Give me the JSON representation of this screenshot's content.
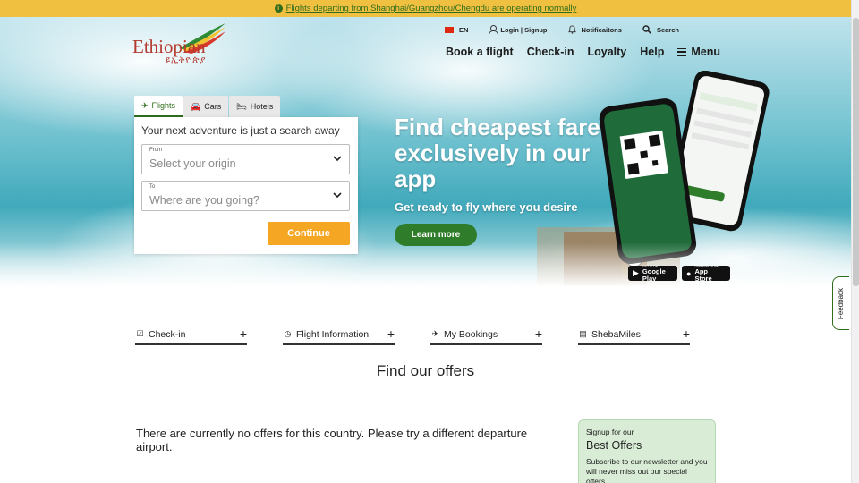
{
  "alert": {
    "text": "Flights departing from Shanghai/Guangzhou/Chengdu are operating normally"
  },
  "logo": {
    "name": "Ethiopian",
    "sub": "ዩኢትዮጵያ"
  },
  "utility_nav": {
    "language": "EN",
    "login": "Login | Signup",
    "notifications": "Notificaitons",
    "search": "Search"
  },
  "main_nav": {
    "items": [
      "Book a flight",
      "Check-in",
      "Loyalty",
      "Help"
    ],
    "menu": "Menu"
  },
  "search": {
    "tabs": [
      "Flights",
      "Cars",
      "Hotels"
    ],
    "active_tab": "Flights",
    "heading": "Your next adventure is just a search away",
    "from_label": "From",
    "from_placeholder": "Select your origin",
    "to_label": "To",
    "to_placeholder": "Where are you going?",
    "continue": "Continue"
  },
  "promo": {
    "title": "Find cheapest fare exclusively in our app",
    "subtitle": "Get ready to fly where you desire",
    "cta": "Learn more",
    "google_play_small": "GET IT ON",
    "google_play": "Google Play",
    "app_store_small": "Download on the",
    "app_store": "App Store"
  },
  "feedback": "Feedback",
  "quick_links": [
    "Check-in",
    "Flight Information",
    "My Bookings",
    "ShebaMiles"
  ],
  "offers": {
    "title": "Find our offers",
    "empty_message": "There are currently no offers for this country. Please try a different departure airport."
  },
  "signup": {
    "small": "Signup for our",
    "big": "Best Offers",
    "desc": "Subscribe to our newsletter and you will never miss out our special offers"
  },
  "colors": {
    "brand_green": "#2f6d1c",
    "accent_yellow": "#f5a623",
    "alert_bg": "#f0c040",
    "logo_red": "#b33a2e"
  }
}
